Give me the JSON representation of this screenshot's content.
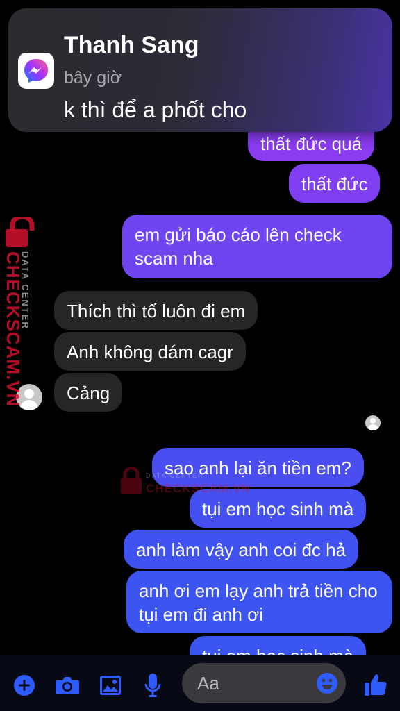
{
  "notification": {
    "sender": "Thanh Sang",
    "time": "bây giờ",
    "message": "k thì để a phốt cho",
    "app_icon": "messenger-icon"
  },
  "watermark": {
    "brand": "CHECKSCAM.VN",
    "tagline": "DATA CENTER"
  },
  "messages": {
    "out_1": "thất đức quá",
    "out_2": "thất đức",
    "out_3": "em gửi báo cáo lên check scam nha",
    "in_1": "Thích thì tố luôn đi em",
    "in_2": "Anh không dám cagr",
    "in_3": "Cảng",
    "out_4": "sao anh lại ăn tiền em?",
    "out_5": "tụi em học sinh mà",
    "out_6": "anh làm vậy anh coi đc hả",
    "out_7": "anh ơi em lạy anh trả tiền cho tụi em đi anh ơi",
    "out_8": "tụi em học sinh mà"
  },
  "composer": {
    "placeholder": "Aa"
  },
  "colors": {
    "incoming_bubble": "#262626",
    "outgoing_purple": "#7a3cf0",
    "outgoing_blue": "#3d55f0",
    "icon_blue": "#2f5cff"
  }
}
